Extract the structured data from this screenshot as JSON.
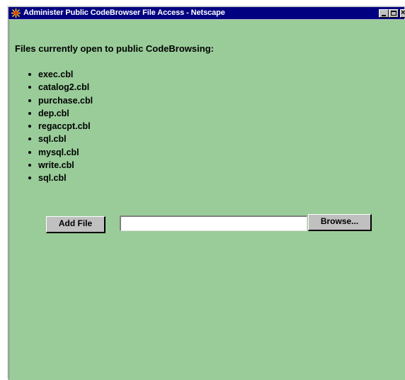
{
  "window": {
    "title": "Administer Public CodeBrowser File Access - Netscape",
    "icon": "netscape-icon",
    "controls": [
      "minimize-icon",
      "maximize-icon",
      "close-icon"
    ]
  },
  "page": {
    "background_color": "#99cc99",
    "heading": "Files currently open to public CodeBrowsing:",
    "files": [
      "exec.cbl",
      "catalog2.cbl",
      "purchase.cbl",
      "dep.cbl",
      "regaccpt.cbl",
      "sql.cbl",
      "mysql.cbl",
      "write.cbl",
      "sql.cbl"
    ],
    "add_file_label": "Add File",
    "file_input_value": "",
    "browse_label": "Browse..."
  },
  "colors": {
    "titlebar": "#000080",
    "page_background": "#99cc99",
    "button_face": "#c0c0c0"
  }
}
